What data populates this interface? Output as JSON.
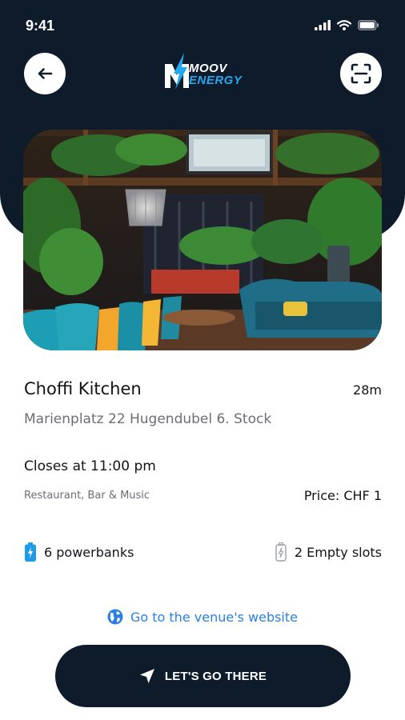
{
  "status_bar": {
    "time": "9:41"
  },
  "header": {
    "logo_line1": "MOOV",
    "logo_line2": "ENERGY"
  },
  "venue": {
    "name": "Choffi Kitchen",
    "distance": "28m",
    "address": "Marienplatz 22 Hugendubel 6. Stock",
    "hours": "Closes at 11:00 pm",
    "category": "Restaurant, Bar & Music",
    "price": "Price: CHF 1"
  },
  "availability": {
    "powerbanks": "6 powerbanks",
    "empty_slots": "2 Empty slots"
  },
  "actions": {
    "website_link": "Go to the venue's website",
    "cta_label": "LET'S GO THERE"
  },
  "colors": {
    "header_bg": "#0d1b2a",
    "accent_blue": "#2b7fe0",
    "battery_blue": "#1e9be8",
    "logo_blue": "#23a9f2"
  }
}
